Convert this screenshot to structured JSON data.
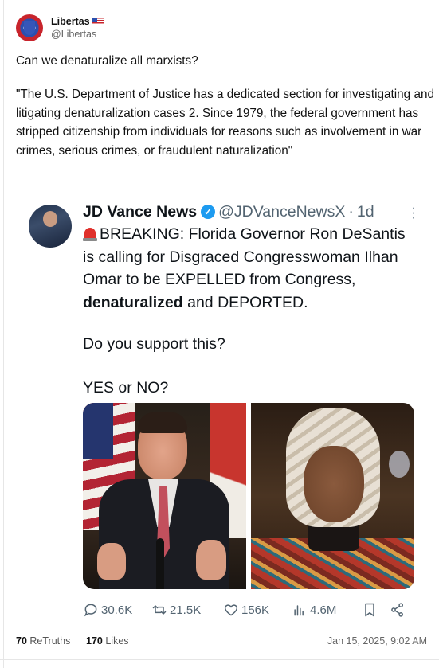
{
  "post": {
    "author": {
      "display_name": "Libertas",
      "flag_icon": "us-flag-emoji",
      "handle": "@Libertas"
    },
    "text_line1": "Can we denaturalize all marxists?",
    "text_quote": "\"The U.S. Department of Justice has a dedicated section for investigating and litigating denaturalization cases 2. Since 1979, the federal government has stripped citizenship from individuals for reasons such as involvement in war crimes, serious crimes, or fraudulent naturalization\""
  },
  "quoted": {
    "name": "JD Vance News",
    "verified_icon": "verified-badge-icon",
    "handle": "@JDVanceNewsX",
    "separator": "·",
    "time": "1d",
    "more_icon": "more-vertical-icon",
    "siren_icon": "police-siren-emoji",
    "text_main_a": "BREAKING: Florida Governor Ron DeSantis is calling for Disgraced Congresswoman Ilhan Omar to be EXPELLED from Congress, ",
    "text_main_bold": "denaturalized",
    "text_main_b": " and DEPORTED.",
    "text_q": "Do you support this?",
    "text_yesno": "YES or NO?",
    "stats": {
      "replies": "30.6K",
      "reposts": "21.5K",
      "likes": "156K",
      "views": "4.6M"
    },
    "colors": {
      "verified": "#1d9bf0",
      "meta": "#536471"
    }
  },
  "footer": {
    "retruths_count": "70",
    "retruths_label": "ReTruths",
    "likes_count": "170",
    "likes_label": "Likes",
    "date": "Jan 15, 2025, 9:02 AM"
  }
}
